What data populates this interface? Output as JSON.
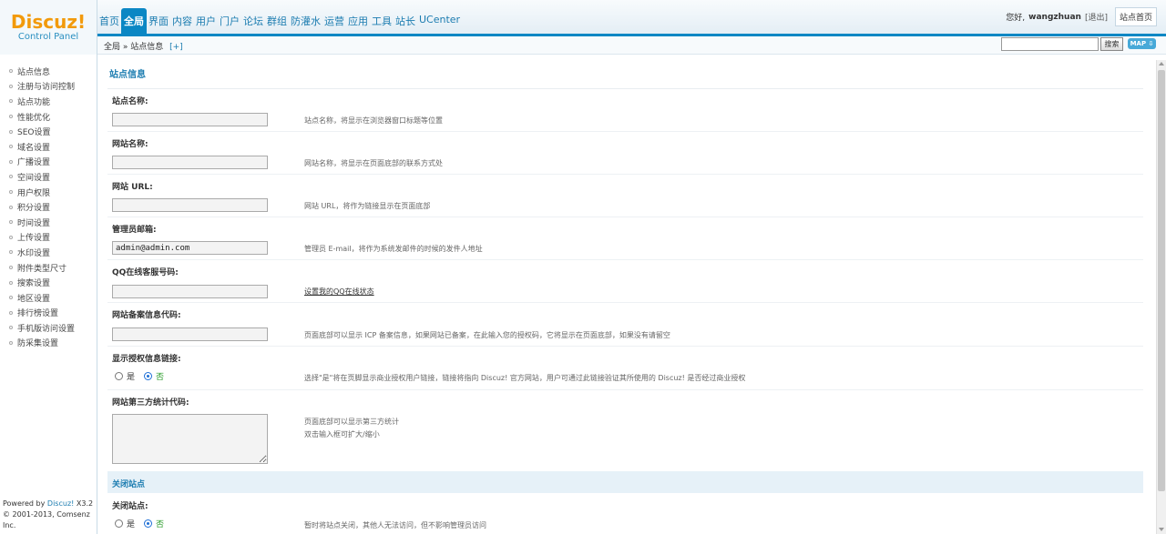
{
  "logo": {
    "brand": "Discuz!",
    "subtitle": "Control Panel"
  },
  "nav": {
    "items": [
      "首页",
      "全局",
      "界面",
      "内容",
      "用户",
      "门户",
      "论坛",
      "群组",
      "防灌水",
      "运营",
      "应用",
      "工具",
      "站长",
      "UCenter"
    ],
    "active": "全局"
  },
  "user": {
    "greeting": "您好,",
    "name": "wangzhuan",
    "logout": "[退出]",
    "site_home": "站点首页"
  },
  "subbar": {
    "breadcrumb": "全局 » 站点信息",
    "expand": "[+]",
    "search_value": "",
    "search_button": "搜索",
    "map_button": "MAP ⇩"
  },
  "sidebar": {
    "items": [
      "站点信息",
      "注册与访问控制",
      "站点功能",
      "性能优化",
      "SEO设置",
      "域名设置",
      "广播设置",
      "空间设置",
      "用户权限",
      "积分设置",
      "时间设置",
      "上传设置",
      "水印设置",
      "附件类型尺寸",
      "搜索设置",
      "地区设置",
      "排行榜设置",
      "手机版访问设置",
      "防采集设置"
    ],
    "footer_powered": "Powered by",
    "footer_brand": "Discuz!",
    "footer_version": "X3.2",
    "footer_copyright": "© 2001-2013, Comsenz Inc."
  },
  "main": {
    "title": "站点信息",
    "fields": {
      "site_name": {
        "label": "站点名称:",
        "value": "",
        "desc": "站点名称，将显示在浏览器窗口标题等位置"
      },
      "web_name": {
        "label": "网站名称:",
        "value": "",
        "desc": "网站名称，将显示在页面底部的联系方式处"
      },
      "site_url": {
        "label": "网站 URL:",
        "value": "",
        "desc": "网站 URL，将作为链接显示在页面底部"
      },
      "admin_email": {
        "label": "管理员邮箱:",
        "value": "admin@admin.com",
        "desc": "管理员 E-mail，将作为系统发邮件的时候的发件人地址"
      },
      "qq_service": {
        "label": "QQ在线客服号码:",
        "value": "",
        "desc": "设置我的QQ在线状态"
      },
      "icp": {
        "label": "网站备案信息代码:",
        "value": "",
        "desc": "页面底部可以显示 ICP 备案信息，如果网站已备案，在此输入您的授权码，它将显示在页面底部，如果没有请留空"
      },
      "license_link": {
        "label": "显示授权信息链接:",
        "yes": "是",
        "no": "否",
        "selected": "否",
        "desc": "选择\"是\"将在页脚显示商业授权用户链接，链接将指向 Discuz! 官方网站，用户可通过此链接验证其所使用的 Discuz! 是否经过商业授权"
      },
      "stats_code": {
        "label": "网站第三方统计代码:",
        "desc1": "页面底部可以显示第三方统计",
        "desc2": "双击输入框可扩大/缩小"
      }
    },
    "section_closed": "关闭站点",
    "close_site": {
      "label": "关闭站点:",
      "yes": "是",
      "no": "否",
      "selected": "否",
      "desc": "暂时将站点关闭，其他人无法访问，但不影响管理员访问"
    }
  }
}
